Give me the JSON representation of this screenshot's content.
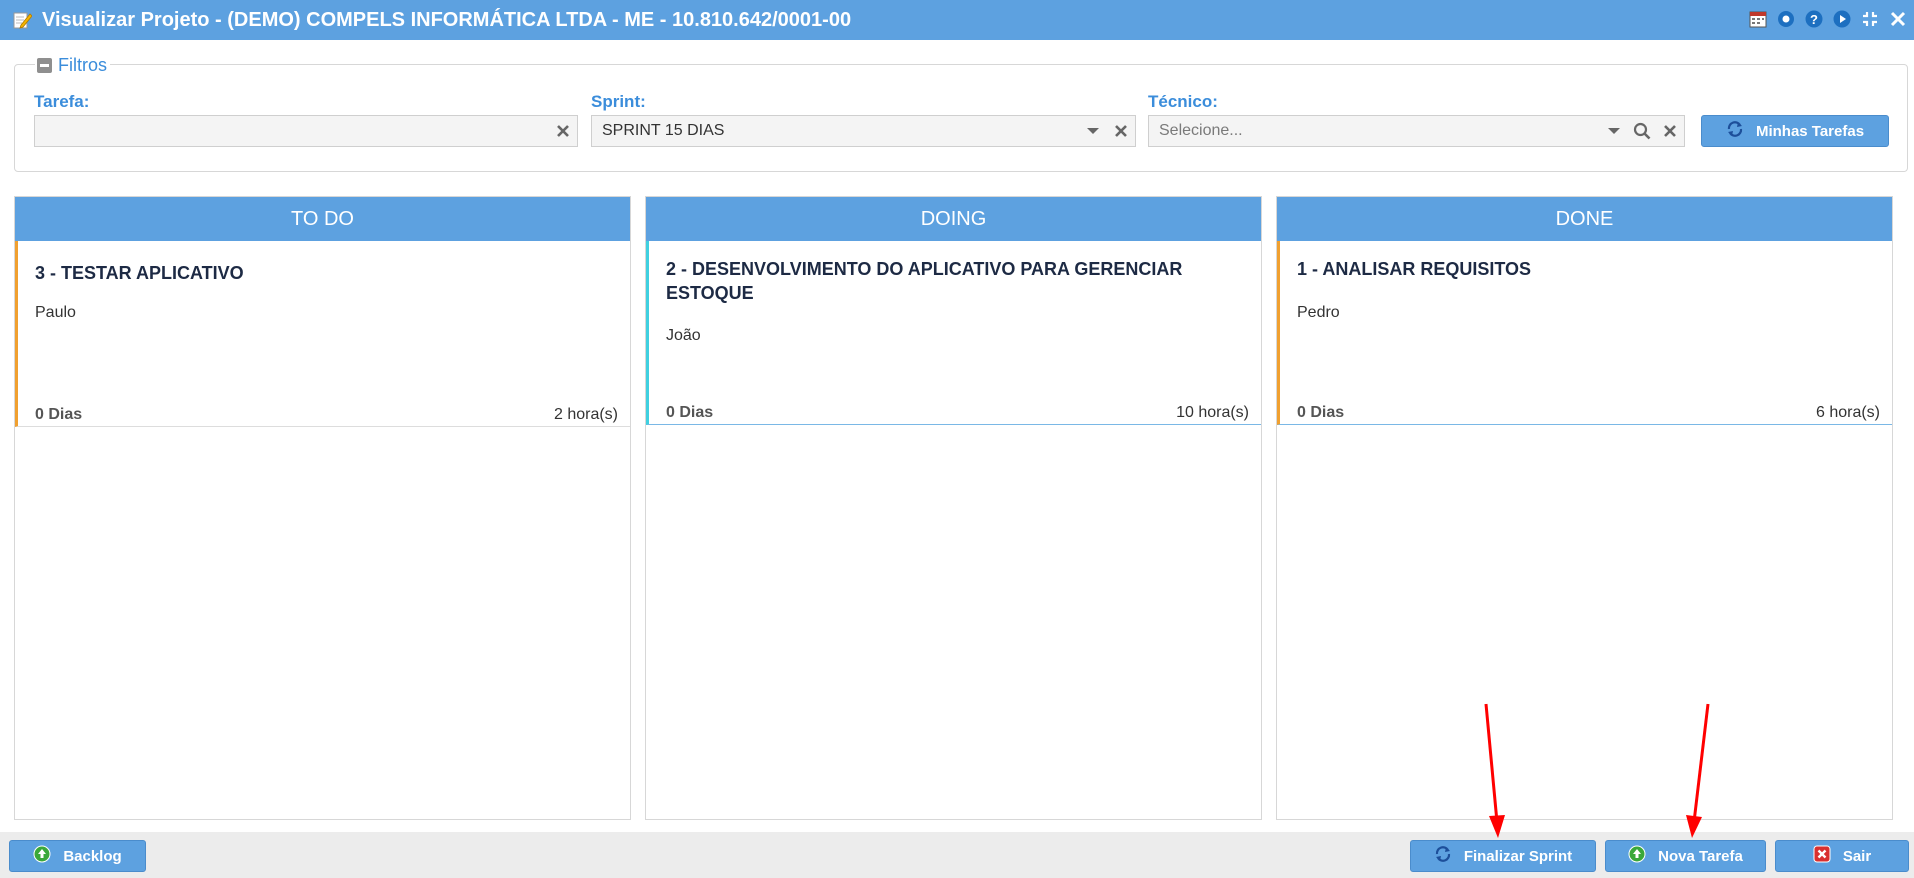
{
  "window": {
    "title": "Visualizar Projeto - (DEMO) COMPELS INFORMÁTICA LTDA - ME - 10.810.642/0001-00",
    "controls": [
      "calendar-icon",
      "record-icon",
      "help-icon",
      "play-icon",
      "compress-icon",
      "close-icon"
    ]
  },
  "filters": {
    "legend": "Filtros",
    "tarefa": {
      "label": "Tarefa:",
      "value": ""
    },
    "sprint": {
      "label": "Sprint:",
      "value": "SPRINT 15 DIAS"
    },
    "tecnico": {
      "label": "Técnico:",
      "placeholder": "Selecione..."
    },
    "minhas_tarefas_label": "Minhas Tarefas"
  },
  "board": {
    "columns": [
      {
        "title": "TO DO",
        "accent": "#f0a030",
        "cards": [
          {
            "title": "3 - TESTAR APLICATIVO",
            "technician": "Paulo",
            "days": "0 Dias",
            "hours": "2 hora(s)"
          }
        ]
      },
      {
        "title": "DOING",
        "accent": "#40d0e0",
        "cards": [
          {
            "title": "2 - DESENVOLVIMENTO DO APLICATIVO PARA GERENCIAR ESTOQUE",
            "technician": "João",
            "days": "0 Dias",
            "hours": "10 hora(s)"
          }
        ]
      },
      {
        "title": "DONE",
        "accent": "#f0a030",
        "cards": [
          {
            "title": "1 - ANALISAR REQUISITOS",
            "technician": "Pedro",
            "days": "0 Dias",
            "hours": "6 hora(s)"
          }
        ]
      }
    ]
  },
  "footer": {
    "backlog_label": "Backlog",
    "finalizar_sprint_label": "Finalizar Sprint",
    "nova_tarefa_label": "Nova Tarefa",
    "sair_label": "Sair"
  },
  "colors": {
    "primary": "#5da1e0",
    "label": "#3b8ddb",
    "annotation": "#ff0000"
  }
}
